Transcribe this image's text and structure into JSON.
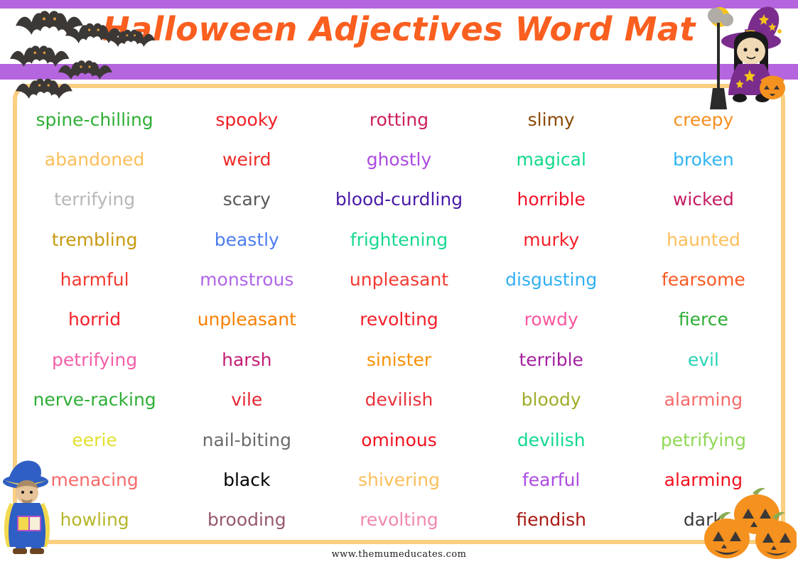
{
  "header": {
    "title": "Halloween Adjectives Word Mat",
    "title_color": "#fa5f20",
    "bar_color": "#b565dd",
    "frame_color": "#fbce80"
  },
  "decorations": {
    "bats": {
      "name": "bats-cluster",
      "count": 6,
      "body_color": "#3c3836",
      "eye_color": "#e09a3c"
    },
    "witch": {
      "name": "witch-illustration",
      "hat_color": "#7b2d8e",
      "robe_color": "#7b2d8e",
      "star_color": "#f5c518",
      "moon_color": "#f5c518",
      "skin_color": "#f0d9b5",
      "hair_color": "#1a1a1a"
    },
    "wizard": {
      "name": "wizard-illustration",
      "robe_color": "#2f5fc4",
      "hat_color": "#2f5fc4",
      "trim_color": "#f2d94e",
      "book_color": "#b551c9"
    },
    "pumpkins": {
      "name": "pumpkins-illustration",
      "count": 3,
      "body_color": "#f5911e",
      "face_color": "#3c3836",
      "stem_color": "#8aab52"
    }
  },
  "grid": {
    "columns": 5,
    "rows": 11,
    "words": [
      {
        "text": "spine-chilling",
        "color": "#2fae36"
      },
      {
        "text": "spooky",
        "color": "#ee1f26"
      },
      {
        "text": "rotting",
        "color": "#cc1f5e"
      },
      {
        "text": "slimy",
        "color": "#8a4a05"
      },
      {
        "text": "creepy",
        "color": "#f78f1e"
      },
      {
        "text": "abandoned",
        "color": "#fbbf5b"
      },
      {
        "text": "weird",
        "color": "#ee2b29"
      },
      {
        "text": "ghostly",
        "color": "#ac4ae0"
      },
      {
        "text": "magical",
        "color": "#12d98b"
      },
      {
        "text": "broken",
        "color": "#31b4f2"
      },
      {
        "text": "terrifying",
        "color": "#b7b7b7"
      },
      {
        "text": "scary",
        "color": "#585858"
      },
      {
        "text": "blood-curdling",
        "color": "#4a1ba8"
      },
      {
        "text": "horrible",
        "color": "#f4122a"
      },
      {
        "text": "wicked",
        "color": "#c41e63"
      },
      {
        "text": "trembling",
        "color": "#c79a10"
      },
      {
        "text": "beastly",
        "color": "#4d7df0"
      },
      {
        "text": "frightening",
        "color": "#18d98e"
      },
      {
        "text": "murky",
        "color": "#f4202a"
      },
      {
        "text": "haunted",
        "color": "#fbbf5b"
      },
      {
        "text": "harmful",
        "color": "#f33a32"
      },
      {
        "text": "monstrous",
        "color": "#b166e8"
      },
      {
        "text": "unpleasant",
        "color": "#f33a32"
      },
      {
        "text": "disgusting",
        "color": "#32b0f4"
      },
      {
        "text": "fearsome",
        "color": "#fb5a24"
      },
      {
        "text": "horrid",
        "color": "#f4202a"
      },
      {
        "text": "unpleasant",
        "color": "#f98004"
      },
      {
        "text": "revolting",
        "color": "#f4202a"
      },
      {
        "text": "rowdy",
        "color": "#f9579f"
      },
      {
        "text": "fierce",
        "color": "#2fae36"
      },
      {
        "text": "petrifying",
        "color": "#f35fa8"
      },
      {
        "text": "harsh",
        "color": "#c41e74"
      },
      {
        "text": "sinister",
        "color": "#f79104"
      },
      {
        "text": "terrible",
        "color": "#a4219f"
      },
      {
        "text": "evil",
        "color": "#28d3b6"
      },
      {
        "text": "nerve-racking",
        "color": "#2fae36"
      },
      {
        "text": "vile",
        "color": "#e62734"
      },
      {
        "text": "devilish",
        "color": "#e8323c"
      },
      {
        "text": "bloody",
        "color": "#a0ad29"
      },
      {
        "text": "alarming",
        "color": "#f76a6a"
      },
      {
        "text": "eerie",
        "color": "#e3e031"
      },
      {
        "text": "nail-biting",
        "color": "#6b6b6b"
      },
      {
        "text": "ominous",
        "color": "#f4121f"
      },
      {
        "text": "devilish",
        "color": "#11d98e"
      },
      {
        "text": "petrifying",
        "color": "#8fd855"
      },
      {
        "text": "menacing",
        "color": "#f76a6a"
      },
      {
        "text": "black",
        "color": "#000000"
      },
      {
        "text": "shivering",
        "color": "#fbbf5b"
      },
      {
        "text": "fearful",
        "color": "#ac4ae0"
      },
      {
        "text": "alarming",
        "color": "#f4121f"
      },
      {
        "text": "howling",
        "color": "#b6b52a"
      },
      {
        "text": "brooding",
        "color": "#96596c"
      },
      {
        "text": "revolting",
        "color": "#f187b0"
      },
      {
        "text": "fiendish",
        "color": "#a81a13"
      },
      {
        "text": "dark",
        "color": "#3a3a3a"
      }
    ]
  },
  "footer": {
    "url": "www.themumeducates.com"
  }
}
